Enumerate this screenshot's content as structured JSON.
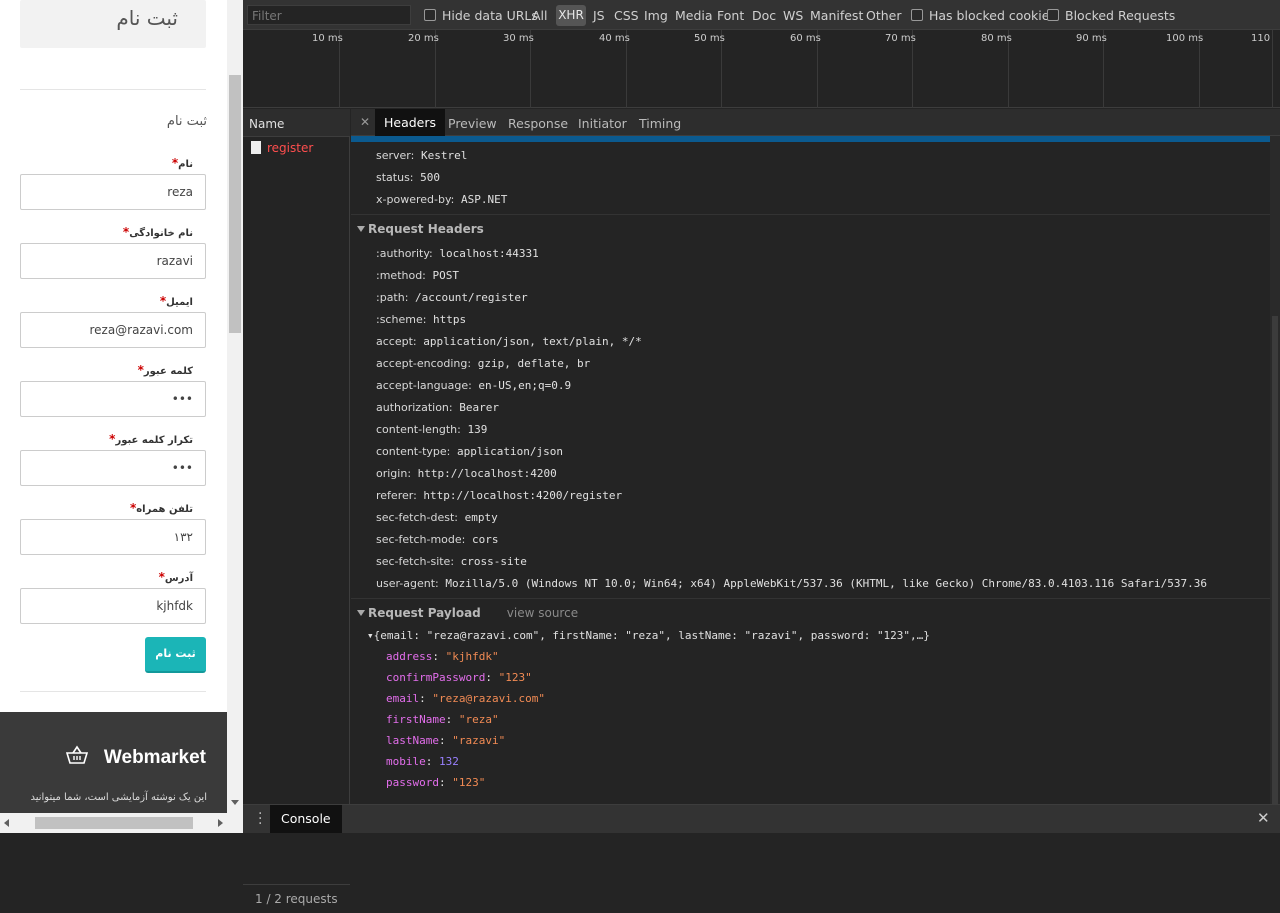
{
  "page": {
    "title": "ثبت نام",
    "form_subtitle": "ثبت نام",
    "fields": [
      {
        "label": "نام",
        "value": "reza"
      },
      {
        "label": "نام خانوادگی",
        "value": "razavi"
      },
      {
        "label": "ایمیل",
        "value": "reza@razavi.com"
      },
      {
        "label": "کلمه عبور",
        "value": "•••"
      },
      {
        "label": "تکرار کلمه عبور",
        "value": "•••"
      },
      {
        "label": "تلفن همراه",
        "value": "۱۳۲"
      },
      {
        "label": "آدرس",
        "value": "kjhfdk"
      }
    ],
    "required_mark": "*",
    "submit_label": "ثبت نام",
    "footer": {
      "brand": "Webmarket",
      "description": "این یک نوشته آزمایشی است، شما میتوانید"
    }
  },
  "devtools": {
    "filter_placeholder": "Filter",
    "hide_data_urls": "Hide data URLs",
    "types": [
      "All",
      "XHR",
      "JS",
      "CSS",
      "Img",
      "Media",
      "Font",
      "Doc",
      "WS",
      "Manifest",
      "Other"
    ],
    "has_blocked_cookies": "Has blocked cookies",
    "blocked_requests": "Blocked Requests",
    "timeline_ticks": [
      "10 ms",
      "20 ms",
      "30 ms",
      "40 ms",
      "50 ms",
      "60 ms",
      "70 ms",
      "80 ms",
      "90 ms",
      "100 ms",
      "110"
    ],
    "name_header": "Name",
    "request_name": "register",
    "request_count": "1 / 2 requests",
    "tabs": [
      "Headers",
      "Preview",
      "Response",
      "Initiator",
      "Timing"
    ],
    "response_headers": [
      {
        "key": "server:",
        "value": "Kestrel"
      },
      {
        "key": "status:",
        "value": "500"
      },
      {
        "key": "x-powered-by:",
        "value": "ASP.NET"
      }
    ],
    "request_headers_title": "Request Headers",
    "request_headers": [
      {
        "key": ":authority:",
        "value": "localhost:44331"
      },
      {
        "key": ":method:",
        "value": "POST"
      },
      {
        "key": ":path:",
        "value": "/account/register"
      },
      {
        "key": ":scheme:",
        "value": "https"
      },
      {
        "key": "accept:",
        "value": "application/json, text/plain, */*"
      },
      {
        "key": "accept-encoding:",
        "value": "gzip, deflate, br"
      },
      {
        "key": "accept-language:",
        "value": "en-US,en;q=0.9"
      },
      {
        "key": "authorization:",
        "value": "Bearer"
      },
      {
        "key": "content-length:",
        "value": "139"
      },
      {
        "key": "content-type:",
        "value": "application/json"
      },
      {
        "key": "origin:",
        "value": "http://localhost:4200"
      },
      {
        "key": "referer:",
        "value": "http://localhost:4200/register"
      },
      {
        "key": "sec-fetch-dest:",
        "value": "empty"
      },
      {
        "key": "sec-fetch-mode:",
        "value": "cors"
      },
      {
        "key": "sec-fetch-site:",
        "value": "cross-site"
      },
      {
        "key": "user-agent:",
        "value": "Mozilla/5.0 (Windows NT 10.0; Win64; x64) AppleWebKit/537.36 (KHTML, like Gecko) Chrome/83.0.4103.116 Safari/537.36"
      }
    ],
    "payload_title": "Request Payload",
    "view_source": "view source",
    "payload_summary": "{email: \"reza@razavi.com\", firstName: \"reza\", lastName: \"razavi\", password: \"123\",…}",
    "payload": [
      {
        "key": "address",
        "value": "\"kjhfdk\"",
        "type": "string"
      },
      {
        "key": "confirmPassword",
        "value": "\"123\"",
        "type": "string"
      },
      {
        "key": "email",
        "value": "\"reza@razavi.com\"",
        "type": "string"
      },
      {
        "key": "firstName",
        "value": "\"reza\"",
        "type": "string"
      },
      {
        "key": "lastName",
        "value": "\"razavi\"",
        "type": "string"
      },
      {
        "key": "mobile",
        "value": "132",
        "type": "number"
      },
      {
        "key": "password",
        "value": "\"123\"",
        "type": "string"
      }
    ],
    "drawer_tab": "Console",
    "colors": {
      "error_red": "#ff4e4e",
      "payload_key": "#e36eec",
      "payload_string": "#f28b54",
      "payload_number": "#9980ff",
      "accent_teal": "#1bb5b7"
    }
  }
}
